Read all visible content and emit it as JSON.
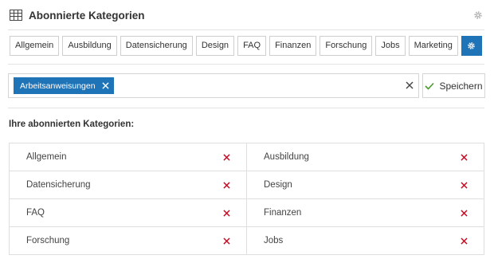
{
  "header": {
    "title": "Abonnierte Kategorien",
    "icon": "table-grid-icon",
    "settings_icon": "gear-icon"
  },
  "tabs": [
    {
      "label": "Allgemein"
    },
    {
      "label": "Ausbildung"
    },
    {
      "label": "Datensicherung"
    },
    {
      "label": "Design"
    },
    {
      "label": "FAQ"
    },
    {
      "label": "Finanzen"
    },
    {
      "label": "Forschung"
    },
    {
      "label": "Jobs"
    },
    {
      "label": "Marketing"
    }
  ],
  "settings_tab": {
    "icon": "gear-icon",
    "active_color": "#1f73b7"
  },
  "selector": {
    "selected_chip": "Arbeitsanweisungen",
    "chip_color": "#1f73b7",
    "clear_icon": "close-icon"
  },
  "save_button": {
    "label": "Speichern",
    "icon": "checkmark-icon",
    "icon_color": "#4a9a2f"
  },
  "subscribed": {
    "heading": "Ihre abonnierten Kategorien:",
    "remove_icon_color": "#d0021b",
    "items": [
      {
        "label": "Allgemein"
      },
      {
        "label": "Ausbildung"
      },
      {
        "label": "Datensicherung"
      },
      {
        "label": "Design"
      },
      {
        "label": "FAQ"
      },
      {
        "label": "Finanzen"
      },
      {
        "label": "Forschung"
      },
      {
        "label": "Jobs"
      }
    ]
  }
}
